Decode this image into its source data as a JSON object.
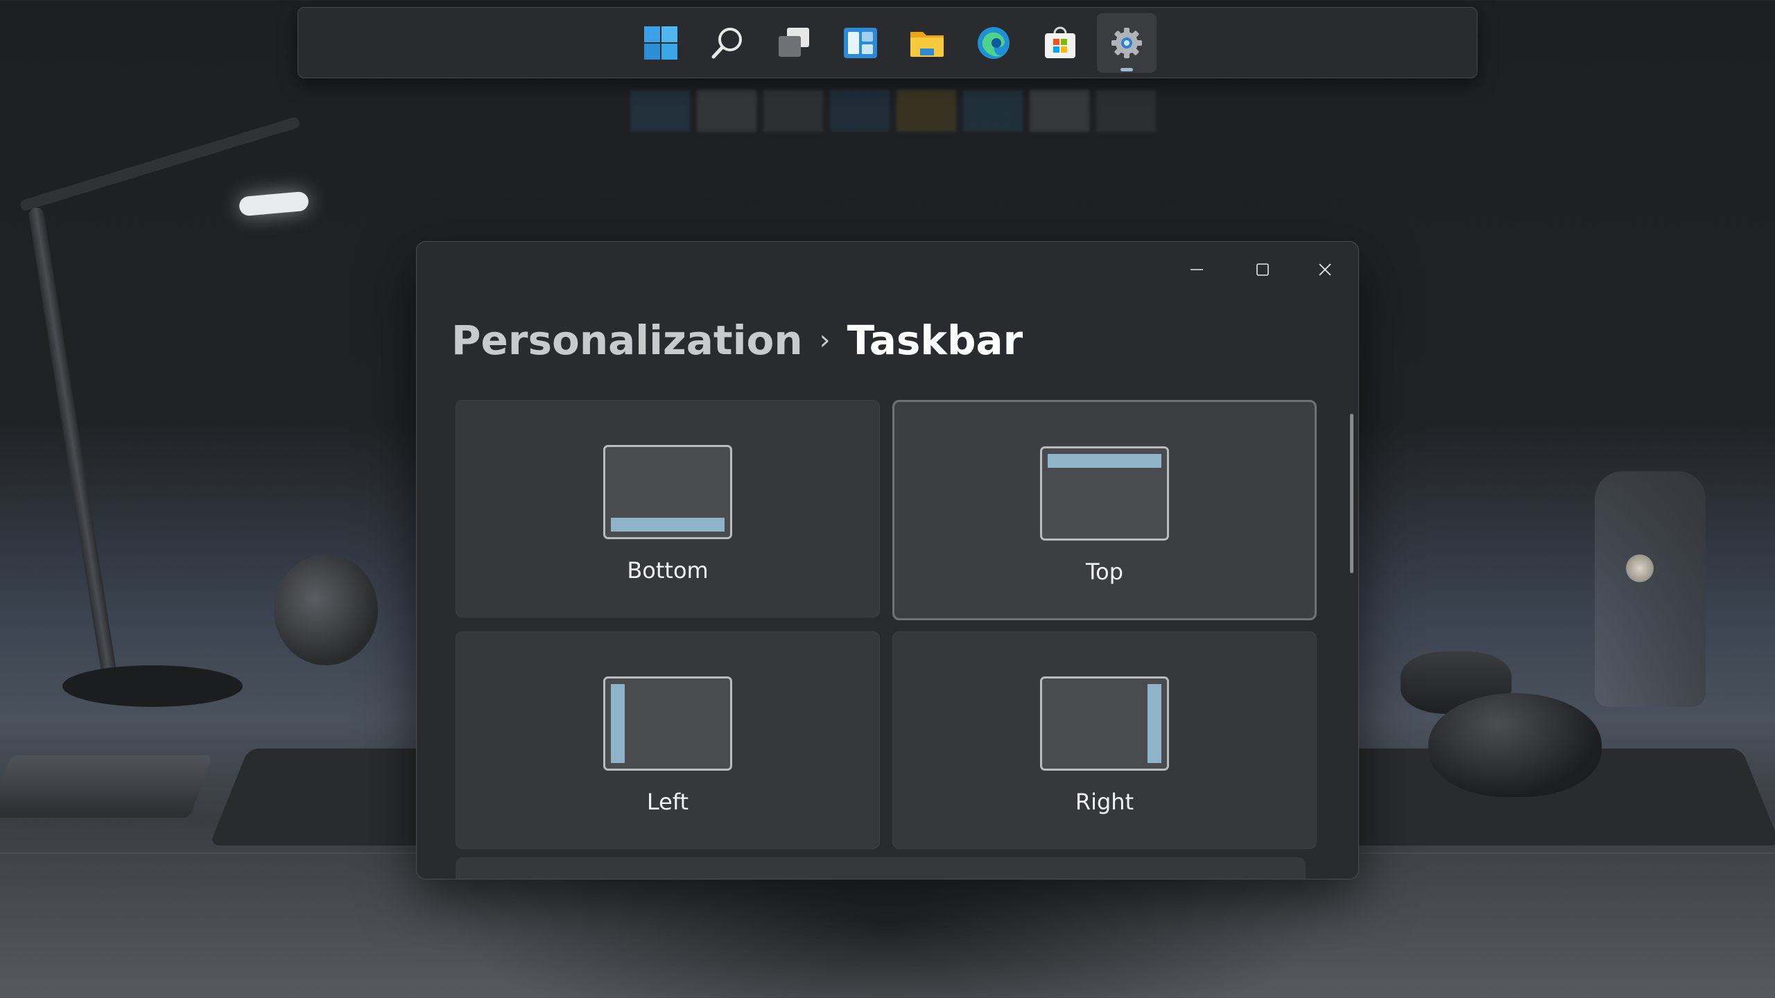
{
  "taskbar": {
    "icons": [
      {
        "name": "start-icon",
        "color": "#3aa0e8"
      },
      {
        "name": "search-icon",
        "color": "#e8e8e8"
      },
      {
        "name": "task-view-icon",
        "color": "#d0d0d0"
      },
      {
        "name": "widgets-icon",
        "color": "#2d8ad6"
      },
      {
        "name": "file-explorer-icon",
        "color": "#f4b728"
      },
      {
        "name": "edge-icon",
        "color": "#2fa6e0"
      },
      {
        "name": "store-icon",
        "color": "#f2f2f2"
      },
      {
        "name": "settings-icon",
        "color": "#b0b4b8",
        "active": true
      }
    ]
  },
  "window": {
    "controls": {
      "minimize": "minimize-icon",
      "maximize": "maximize-icon",
      "close": "close-icon"
    },
    "breadcrumb": {
      "parent": "Personalization",
      "separator": "›",
      "current": "Taskbar"
    },
    "options": [
      {
        "label": "Bottom",
        "position": "bottom",
        "selected": false
      },
      {
        "label": "Top",
        "position": "top",
        "selected": true
      },
      {
        "label": "Left",
        "position": "left",
        "selected": false
      },
      {
        "label": "Right",
        "position": "right",
        "selected": false
      }
    ],
    "accent_color": "#8fb4c9"
  }
}
